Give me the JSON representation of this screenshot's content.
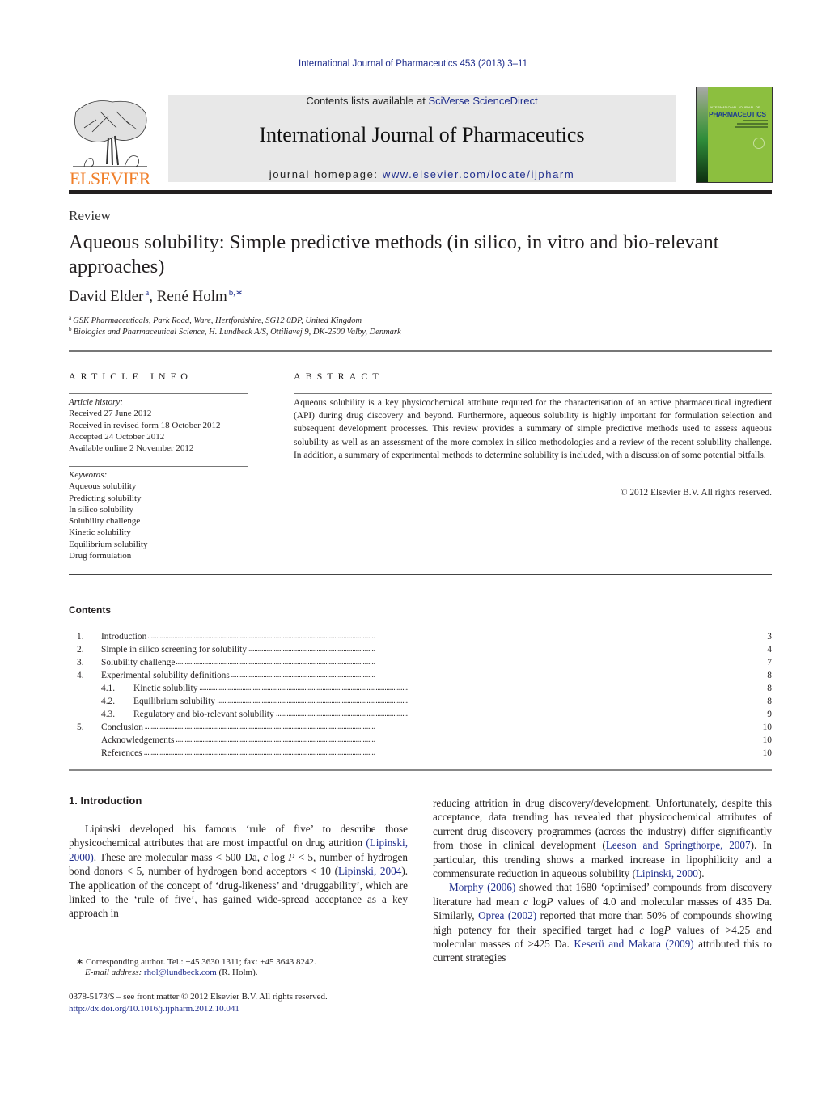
{
  "header": {
    "citation": "International Journal of Pharmaceutics 453 (2013) 3–11",
    "contents_prefix": "Contents lists available at ",
    "contents_link": "SciVerse ScienceDirect",
    "journal_title": "International Journal of Pharmaceutics",
    "homepage_prefix": "journal homepage: ",
    "homepage_link": "www.elsevier.com/locate/ijpharm",
    "publisher_logo": "ELSEVIER",
    "cover": {
      "top_text": "INTERNATIONAL JOURNAL OF",
      "title": "PHARMACEUTICS"
    }
  },
  "article": {
    "type": "Review",
    "title": "Aqueous solubility: Simple predictive methods (in silico, in vitro and bio-relevant approaches)",
    "authors": [
      {
        "name": "David Elder",
        "sup": "a"
      },
      {
        "name": "René Holm",
        "sup": "b,∗"
      }
    ],
    "affiliations": [
      {
        "sup": "a",
        "text": "GSK Pharmaceuticals, Park Road, Ware, Hertfordshire, SG12 0DP, United Kingdom"
      },
      {
        "sup": "b",
        "text": "Biologics and Pharmaceutical Science, H. Lundbeck A/S, Ottiliavej 9, DK-2500 Valby, Denmark"
      }
    ]
  },
  "article_info": {
    "heading": "ARTICLE INFO",
    "history_label": "Article history:",
    "history": [
      "Received 27 June 2012",
      "Received in revised form 18 October 2012",
      "Accepted 24 October 2012",
      "Available online 2 November 2012"
    ],
    "keywords_label": "Keywords:",
    "keywords": [
      "Aqueous solubility",
      "Predicting solubility",
      "In silico solubility",
      "Solubility challenge",
      "Kinetic solubility",
      "Equilibrium solubility",
      "Drug formulation"
    ]
  },
  "abstract": {
    "heading": "ABSTRACT",
    "text": "Aqueous solubility is a key physicochemical attribute required for the characterisation of an active pharmaceutical ingredient (API) during drug discovery and beyond. Furthermore, aqueous solubility is highly important for formulation selection and subsequent development processes. This review provides a summary of simple predictive methods used to assess aqueous solubility as well as an assessment of the more complex in silico methodologies and a review of the recent solubility challenge. In addition, a summary of experimental methods to determine solubility is included, with a discussion of some potential pitfalls.",
    "copyright": "© 2012 Elsevier B.V. All rights reserved."
  },
  "contents": {
    "heading": "Contents",
    "items": [
      {
        "num": "1.",
        "label": "Introduction",
        "page": "3",
        "sub": false
      },
      {
        "num": "2.",
        "label": "Simple in silico screening for solubility",
        "page": "4",
        "sub": false
      },
      {
        "num": "3.",
        "label": "Solubility challenge",
        "page": "7",
        "sub": false
      },
      {
        "num": "4.",
        "label": "Experimental solubility definitions",
        "page": "8",
        "sub": false
      },
      {
        "num": "4.1.",
        "label": "Kinetic solubility",
        "page": "8",
        "sub": true
      },
      {
        "num": "4.2.",
        "label": "Equilibrium solubility",
        "page": "8",
        "sub": true
      },
      {
        "num": "4.3.",
        "label": "Regulatory and bio-relevant solubility",
        "page": "9",
        "sub": true
      },
      {
        "num": "5.",
        "label": "Conclusion",
        "page": "10",
        "sub": false
      },
      {
        "num": "",
        "label": "Acknowledgements",
        "page": "10",
        "sub": false
      },
      {
        "num": "",
        "label": "References",
        "page": "10",
        "sub": false
      }
    ]
  },
  "body": {
    "section_heading": "1.  Introduction",
    "left": {
      "t1": "Lipinski developed his famous ‘rule of five’ to describe those physicochemical attributes that are most impactful on drug attrition ",
      "ref1": "(Lipinski, 2000)",
      "t2": ". These are molecular mass < 500 Da, ",
      "clogp1": "c",
      "clogp2": " log ",
      "clogp3": "P",
      "t3": " < 5, number of hydrogen bond donors < 5, number of hydrogen bond acceptors < 10 (",
      "ref2": "Lipinski, 2004",
      "t4": "). The application of the concept of ‘drug-likeness’ and ‘druggability’, which are linked to the ‘rule of five’, has gained wide-spread acceptance as a key approach in"
    },
    "right": {
      "p1a": "reducing attrition in drug discovery/development. Unfortunately, despite this acceptance, data trending has revealed that physicochemical attributes of current drug discovery programmes (across the industry) differ significantly from those in clinical development (",
      "ref1": "Leeson and Springthorpe, 2007",
      "p1b": "). In particular, this trending shows a marked increase in lipophilicity and a commensurate reduction in aqueous solubility (",
      "ref2": "Lipinski, 2000",
      "p1c": ").",
      "ref3": "Morphy (2006)",
      "p2a": " showed that 1680 ‘optimised’ compounds from discovery literature had mean ",
      "p2b": " values of 4.0 and molecular masses of 435 Da. Similarly, ",
      "ref4": "Oprea (2002)",
      "p2c": " reported that more than 50% of compounds showing high potency for their specified target had ",
      "p2d": " values of >4.25 and molecular masses of >425 Da. ",
      "ref5": "Keserü and Makara (2009)",
      "p2e": " attributed this to current strategies",
      "clogp_c": "c",
      "clogp_log": " log",
      "clogp_p": "P"
    }
  },
  "footnotes": {
    "corresponding": "∗ Corresponding author. Tel.: +45 3630 1311; fax: +45 3643 8242.",
    "email_label": "E-mail address: ",
    "email": "rhol@lundbeck.com",
    "email_suffix": " (R. Holm).",
    "front_matter": "0378-5173/$ – see front matter © 2012 Elsevier B.V. All rights reserved.",
    "doi": "http://dx.doi.org/10.1016/j.ijpharm.2012.10.041"
  }
}
